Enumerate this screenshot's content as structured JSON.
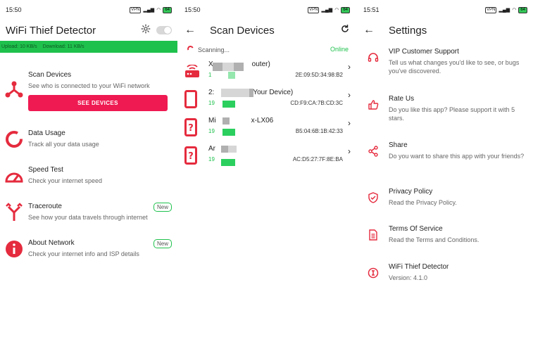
{
  "screen1": {
    "status_time": "15:50",
    "status_vpn": "VPN",
    "status_battery": "64",
    "title": "WiFi Thief Detector",
    "upload_label": "Upload: 10 KB/s",
    "download_label": "Download: 11 KB/s",
    "items": [
      {
        "title": "Scan Devices",
        "subtitle": "See who is connected to your WiFi network",
        "button": "SEE DEVICES",
        "icon": "router-network-icon"
      },
      {
        "title": "Data Usage",
        "subtitle": "Track all your data usage",
        "icon": "data-usage-icon"
      },
      {
        "title": "Speed Test",
        "subtitle": "Check your internet speed",
        "icon": "speedometer-icon"
      },
      {
        "title": "Traceroute",
        "subtitle": "See how your data travels through internet",
        "badge": "New",
        "icon": "traceroute-icon"
      },
      {
        "title": "About Network",
        "subtitle": "Check your internet info and ISP details",
        "badge": "New",
        "icon": "info-icon"
      }
    ]
  },
  "screen2": {
    "status_time": "15:50",
    "status_vpn": "VPN",
    "status_battery": "64",
    "title": "Scan Devices",
    "scanning_label": "Scanning...",
    "online_label": "Online",
    "devices": [
      {
        "name_prefix": "X",
        "name_suffix": "outer)",
        "ip": "1",
        "mac": "2E:09:5D:34:98:B2",
        "icon": "router-icon"
      },
      {
        "name_prefix": "2:",
        "name_suffix": "Your Device)",
        "ip": "19",
        "mac": "CD:F9:CA:7B:CD:3C",
        "icon": "phone-icon"
      },
      {
        "name_prefix": "Mi",
        "name_suffix": "x-LX06",
        "ip": "19",
        "mac": "B5:04:6B:1B:42:33",
        "icon": "unknown-device-icon"
      },
      {
        "name_prefix": "Ar",
        "name_suffix": "",
        "ip": "19",
        "mac": "AC:D5:27:7F:8E:BA",
        "icon": "unknown-device-icon"
      }
    ]
  },
  "screen3": {
    "status_time": "15:51",
    "status_vpn": "VPN",
    "status_battery": "64",
    "title": "Settings",
    "items": [
      {
        "title": "VIP Customer Support",
        "subtitle": "Tell us what changes you'd like to see, or bugs you've discovered.",
        "icon": "headset-icon"
      },
      {
        "title": "Rate Us",
        "subtitle": "Do you like this app? Please support it with 5 stars.",
        "icon": "thumbs-up-icon"
      },
      {
        "title": "Share",
        "subtitle": "Do you want to share this app with your friends?",
        "icon": "share-icon"
      },
      {
        "title": "Privacy Policy",
        "subtitle": "Read the Privacy Policy.",
        "icon": "shield-check-icon"
      },
      {
        "title": "Terms Of Service",
        "subtitle": "Read the Terms and Conditions.",
        "icon": "document-icon"
      },
      {
        "title": "WiFi Thief Detector",
        "subtitle": "Version: 4.1.0",
        "icon": "app-info-icon"
      }
    ]
  },
  "colors": {
    "accent": "#e52b3e",
    "button": "#ef1a52",
    "online_green": "#1fc14d"
  }
}
